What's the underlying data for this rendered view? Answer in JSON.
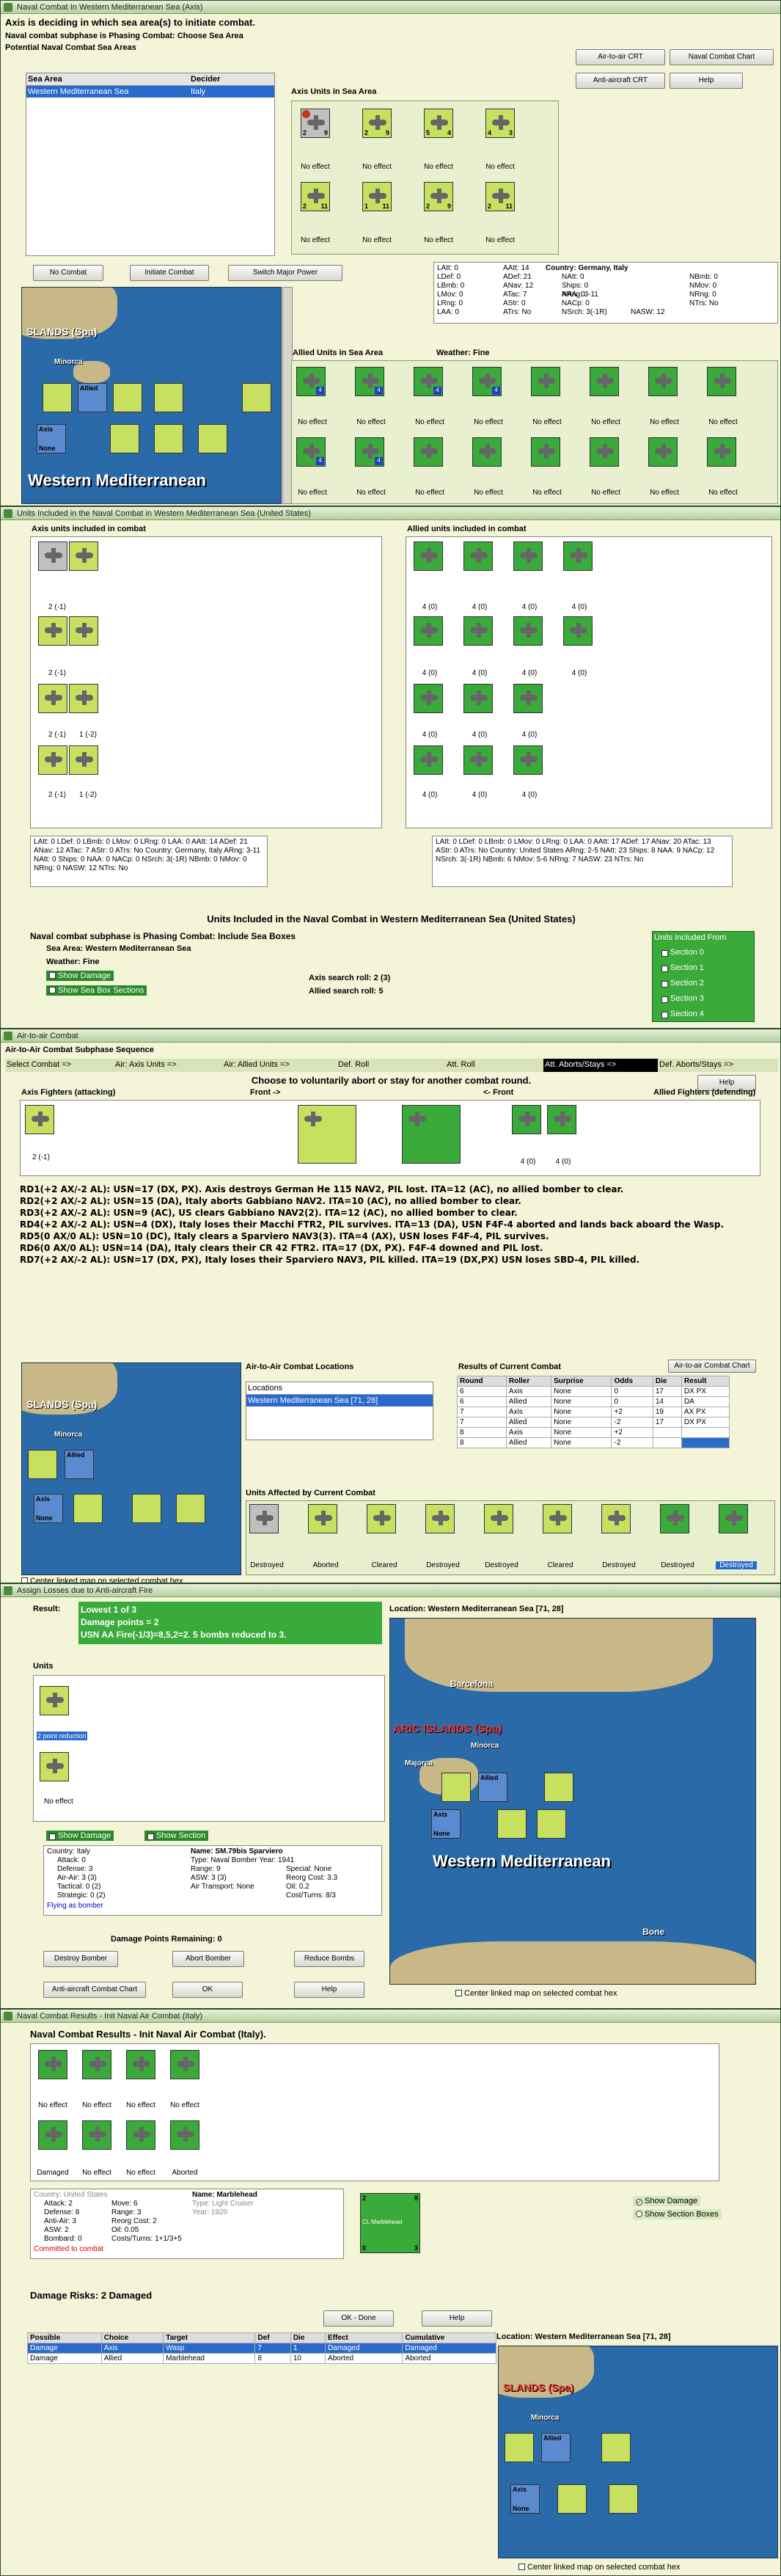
{
  "w1": {
    "title": "Naval Combat In Western Mediterranean Sea (Axis)",
    "heading": "Axis is deciding in which sea area(s) to initiate combat.",
    "phase": "Naval combat subphase is Phasing Combat: Choose Sea Area",
    "potential": "Potential Naval Combat Sea Areas",
    "col_sea": "Sea Area",
    "col_decider": "Decider",
    "sea_row": "Western Mediterranean Sea",
    "decider_row": "Italy",
    "btn_aircrt": "Air-to-air CRT",
    "btn_navalchart": "Naval Combat Chart",
    "btn_antiair": "Anti-aircraft CRT",
    "btn_help": "Help",
    "axis_units_label": "Axis Units in Sea Area",
    "btn_nocombat": "No Combat",
    "btn_initiate": "Initiate Combat",
    "btn_switch": "Switch Major Power",
    "country": "Country: Germany, Italy",
    "allied_label": "Allied Units in Sea Area",
    "weather": "Weather:  Fine",
    "noeffect": "No effect",
    "map_islands": "SLANDS (Spa)",
    "map_minorca": "Minorca",
    "map_sea": "Western Mediterranean",
    "axis_label": "Axis",
    "allied_short": "Allied",
    "none_label": "None",
    "stats": [
      "LAtt: 0",
      "LDef: 0",
      "LBmb: 0",
      "LMov: 0",
      "LRng: 0",
      "LAA: 0",
      "AAtt: 14",
      "ADef: 21",
      "ANav: 12",
      "ATac: 7",
      "AStr: 0",
      "ATrs: No",
      "NAtt: 0",
      "Ships: 0",
      "NAA: 0",
      "NACp: 0",
      "NSrch: 3(-1R)",
      "ARng: 3-11",
      "NASW: 12",
      "NBmb: 0",
      "NMov: 0",
      "NRng: 0",
      "NTrs: No"
    ]
  },
  "w2": {
    "title": "Units Included in the Naval Combat in Western Mediterranean Sea (United States)",
    "axis_incl": "Axis units included in combat",
    "allied_incl": "Allied units included in combat",
    "heading": "Units Included in the Naval Combat in Western Mediterranean Sea (United States)",
    "phase": "Naval combat subphase is Phasing Combat: Include Sea Boxes",
    "sea_area": "Sea Area:  Western Mediterranean Sea",
    "weather": "Weather:  Fine",
    "show_damage": "Show Damage",
    "show_sections": "Show Sea Box Sections",
    "axis_search": "Axis search roll:  2 (3)",
    "allied_search": "Allied search roll:  5",
    "units_from": "Units Included From",
    "sections": [
      "Section 0",
      "Section 1",
      "Section 2",
      "Section 3",
      "Section 4"
    ],
    "axis_caps": [
      "2 (-1)",
      "2 (-1)",
      "2 (-1)",
      "1 (-2)",
      "2 (-1)",
      "1 (-2)"
    ],
    "allied_cap": "4 (0)",
    "axis_stats": "LAtt: 0  LDef: 0  LBmb: 0  LMov: 0  LRng: 0  LAA: 0   AAtt: 14  ADef: 21  ANav: 12  ATac: 7  AStr: 0  ATrs: No   Country: Germany, Italy  ARng: 3-11  NAtt: 0 Ships: 0 NAA: 0 NACp: 0 NSrch: 3(-1R)  NBmb: 0 NMov: 0 NRng: 0 NASW: 12 NTrs: No",
    "allied_stats": "LAtt: 0  LDef: 0  LBmb: 0  LMov: 0  LRng: 0  LAA: 0   AAtt: 17  ADef: 17  ANav: 20  ATac: 13  AStr: 0  ATrs: No   Country: United States  ARng: 2-5  NAtt: 23 Ships: 8 NAA: 9 NACp: 12 NSrch: 3(-1R)  NBmb: 6 NMov: 5-6 NRng: 7 NASW: 23 NTrs: No"
  },
  "w3": {
    "title": "Air-to-air Combat",
    "heading": "Air-to-Air Combat Subphase Sequence",
    "steps": [
      "Select Combat =>",
      "Air: Axis Units =>",
      "Air: Allied Units =>",
      "Def. Roll",
      "Att. Roll",
      "Att. Aborts/Stays =>",
      "Def. Aborts/Stays =>"
    ],
    "choose": "Choose to voluntarily abort or stay for another combat round.",
    "btn_help": "Help",
    "axis_fighters": "Axis Fighters (attacking)",
    "front1": "Front ->",
    "front2": "<- Front",
    "allied_fighters": "Allied Fighters (defending)",
    "caps": [
      "2 (-1)",
      "4 (0)",
      "4 (0)",
      "4 (0)"
    ],
    "rounds": [
      "RD1(+2 AX/-2 AL): USN=17 (DX, PX). Axis destroys German He 115 NAV2, PIL lost. ITA=12 (AC), no allied bomber to clear.",
      "RD2(+2 AX/-2 AL): USN=15 (DA), Italy aborts Gabbiano NAV2. ITA=10 (AC), no allied bomber to clear.",
      "RD3(+2 AX/-2 AL): USN=9 (AC), US clears Gabbiano NAV2(2). ITA=12 (AC), no allied bomber to clear.",
      "RD4(+2 AX/-2 AL): USN=4 (DX), Italy loses their Macchi FTR2, PIL survives. ITA=13 (DA), USN F4F-4 aborted and lands back aboard the Wasp.",
      "RD5(0 AX/0 AL): USN=10 (DC), Italy clears a Sparviero NAV3(3). ITA=4 (AX), USN loses F4F-4, PIL survives.",
      "RD6(0 AX/0 AL): USN=14 (DA), Italy clears their CR 42 FTR2. ITA=17 (DX, PX). F4F-4 downed and PIL lost.",
      "RD7(+2 AX/-2 AL): USN=17 (DX, PX), Italy loses their Sparviero NAV3, PIL killed. ITA=19 (DX,PX) USN loses SBD-4, PIL killed."
    ],
    "locations_label": "Air-to-Air Combat Locations",
    "loc_col": "Locations",
    "loc_row": "Western Mediterranean Sea [71, 28]",
    "results_label": "Results of Current Combat",
    "btn_chart": "Air-to-air Combat Chart",
    "res_head": [
      "Round",
      "Roller",
      "Surprise",
      "Odds",
      "Die",
      "Result"
    ],
    "res_rows": [
      [
        "6",
        "Axis",
        "None",
        "0",
        "17",
        "DX PX"
      ],
      [
        "6",
        "Allied",
        "None",
        "0",
        "14",
        "DA"
      ],
      [
        "7",
        "Axis",
        "None",
        "+2",
        "19",
        "AX PX"
      ],
      [
        "7",
        "Allied",
        "None",
        "-2",
        "17",
        "DX PX"
      ],
      [
        "8",
        "Axis",
        "None",
        "+2",
        "",
        ""
      ],
      [
        "8",
        "Allied",
        "None",
        "-2",
        "",
        ""
      ]
    ],
    "affected_label": "Units Affected by Current Combat",
    "affected": [
      "Destroyed",
      "Aborted",
      "Cleared",
      "Destroyed",
      "Destroyed",
      "Cleared",
      "Destroyed",
      "Destroyed",
      "Destroyed"
    ],
    "center_linked": "Center linked map on selected combat hex"
  },
  "w4": {
    "title": "Assign Losses due to Anti-aircraft Fire",
    "result_label": "Result:",
    "result_lines": [
      "Lowest 1 of 3",
      "Damage points = 2",
      "USN AA Fire(-1/3)=8,5,2=2.  5 bombs reduced to 3."
    ],
    "location": "Location:  Western Mediterranean Sea [71, 28]",
    "units_label": "Units",
    "unit_note1": "2 point reduction",
    "unit_note2": "No effect",
    "show_damage": "Show Damage",
    "show_section": "Show Section",
    "country": "Country: Italy",
    "left_stats": [
      "Attack: 0",
      "Defense: 3",
      "Air-Air: 3 (3)",
      "Tactical: 0 (2)",
      "Strategic: 0 (2)"
    ],
    "flying": "Flying as bomber",
    "name": "Name: SM.79bis Sparviero",
    "type": "Type: Naval Bomber  Year: 1941",
    "mid_stats": [
      "Range: 9",
      "ASW: 3 (3)",
      "Air Transport: None",
      "Special: None",
      "Reorg Cost: 3.3",
      "Oil: 0.2",
      "Cost/Turns: 8/3"
    ],
    "dmg_left": "Damage Points Remaining:  0",
    "btn_destroy": "Destroy Bomber",
    "btn_abort": "Abort Bomber",
    "btn_reduce": "Reduce Bombs",
    "btn_aachart": "Anti-aircraft Combat Chart",
    "btn_ok": "OK",
    "btn_help": "Help",
    "map_barcelona": "Barcelona",
    "map_islands": "ARIC ISLANDS (Spa)",
    "map_majorca": "Majorca",
    "map_minorca": "Minorca",
    "map_sea": "Western Mediterranean",
    "map_bone": "Bone",
    "center_linked": "Center linked map on selected combat hex"
  },
  "w5": {
    "title": "Naval Combat Results - Init Naval Air Combat (Italy)",
    "heading": "Naval Combat Results - Init Naval Air Combat (Italy).",
    "caps_top": [
      "No effect",
      "No effect",
      "No effect",
      "No effect"
    ],
    "caps_bot": [
      "Damaged",
      "No effect",
      "No effect",
      "Aborted"
    ],
    "country": "Country: United States",
    "left_stats": [
      "Attack: 2",
      "Defense: 8",
      "Anti-Air: 3",
      "ASW: 2",
      "Bombard: 0"
    ],
    "committed": "Committed to combat",
    "mid_stats": [
      "Move: 6",
      "Range: 3",
      "Reorg Cost: 2",
      "Oil: 0.05",
      "Costs/Turns: 1+1/3+5"
    ],
    "name": "Name: Marblehead",
    "type": "Type: Light Cruiser",
    "year": "Year: 1920",
    "ship_label": "CL Marblehead",
    "show_damage": "Show Damage",
    "show_sections": "Show Section Boxes",
    "damage_risks": "Damage Risks:  2 Damaged",
    "btn_ok": "OK - Done",
    "btn_help": "Help",
    "dmg_head": [
      "Possible",
      "Choice",
      "Target",
      "Def",
      "Die",
      "Effect",
      "Cumulative"
    ],
    "dmg_rows": [
      [
        "Damage",
        "Axis",
        "Wasp",
        "7",
        "1",
        "Damaged",
        "Damaged"
      ],
      [
        "Damage",
        "Allied",
        "Marblehead",
        "8",
        "10",
        "Aborted",
        "Aborted"
      ]
    ],
    "location": "Location:  Western Mediterranean Sea [71, 28]",
    "map_islands": "SLANDS (Spa)",
    "map_minorca": "Minorca",
    "center_linked": "Center linked map on selected combat hex"
  }
}
